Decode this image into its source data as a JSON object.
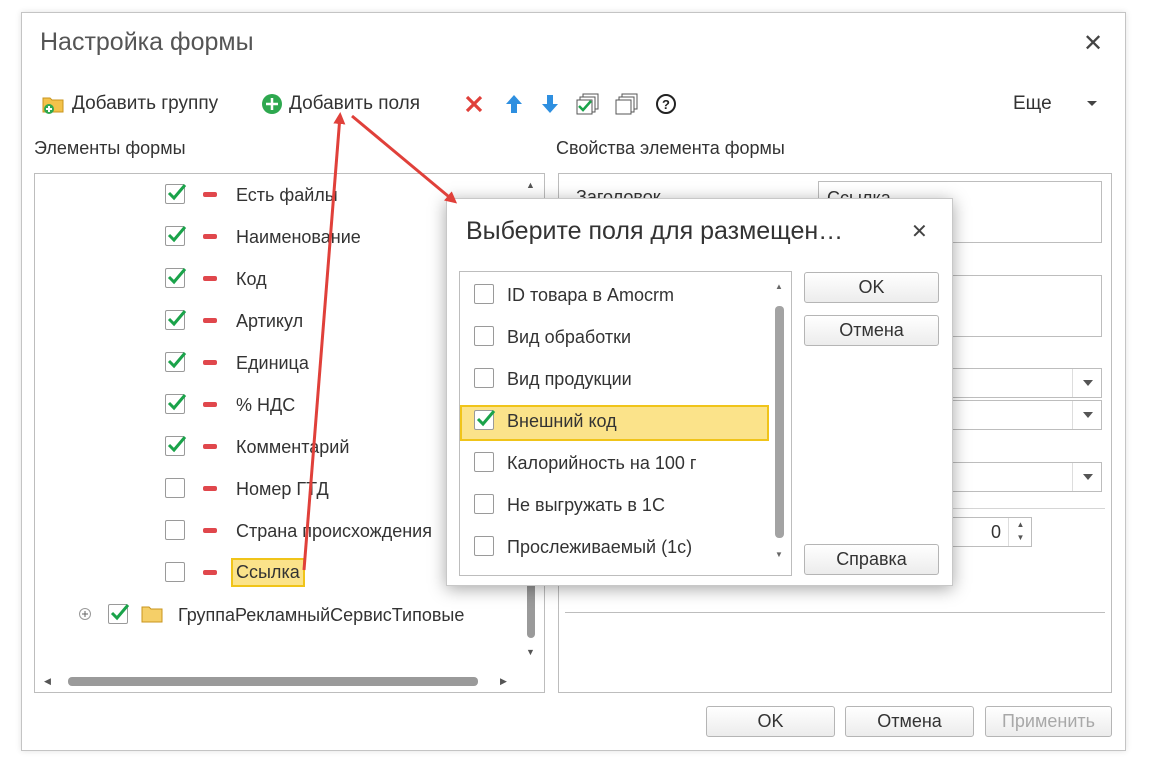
{
  "window": {
    "title": "Настройка формы",
    "toolbar": {
      "add_group_label": "Добавить группу",
      "add_fields_label": "Добавить поля",
      "more_label": "Еще"
    },
    "tree_section_label": "Элементы формы",
    "props_section_label": "Свойства элемента формы",
    "tree_items": [
      {
        "label": "Есть файлы",
        "checked": true
      },
      {
        "label": "Наименование",
        "checked": true
      },
      {
        "label": "Код",
        "checked": true
      },
      {
        "label": "Артикул",
        "checked": true
      },
      {
        "label": "Единица",
        "checked": true
      },
      {
        "label": "% НДС",
        "checked": true
      },
      {
        "label": "Комментарий",
        "checked": true
      },
      {
        "label": "Номер ГТД",
        "checked": false
      },
      {
        "label": "Страна происхождения",
        "checked": false
      },
      {
        "label": "Ссылка",
        "checked": false,
        "selected": true
      }
    ],
    "tree_group": {
      "label": "ГруппаРекламныйСервисТиповые",
      "checked": true
    },
    "props": {
      "title_label": "Заголовок",
      "title_value": "Ссылка",
      "number_value": "0"
    },
    "buttons": {
      "ok": "OK",
      "cancel": "Отмена",
      "apply": "Применить"
    }
  },
  "dialog": {
    "title": "Выберите поля для размещен…",
    "items": [
      {
        "label": "ID товара в Amocrm",
        "checked": false
      },
      {
        "label": "Вид обработки",
        "checked": false
      },
      {
        "label": "Вид продукции",
        "checked": false
      },
      {
        "label": "Внешний код",
        "checked": true,
        "selected": true
      },
      {
        "label": "Калорийность на 100 г",
        "checked": false
      },
      {
        "label": "Не выгружать в 1С",
        "checked": false
      },
      {
        "label": "Прослеживаемый (1с)",
        "checked": false
      }
    ],
    "buttons": {
      "ok": "OK",
      "cancel": "Отмена",
      "help": "Справка"
    }
  },
  "colors": {
    "check_green": "#1aa34a",
    "remove_red": "#e0474c",
    "selection_yellow": "#fbe38a",
    "arrow_red": "#e0403a",
    "up_down_blue": "#2e8fe0"
  }
}
